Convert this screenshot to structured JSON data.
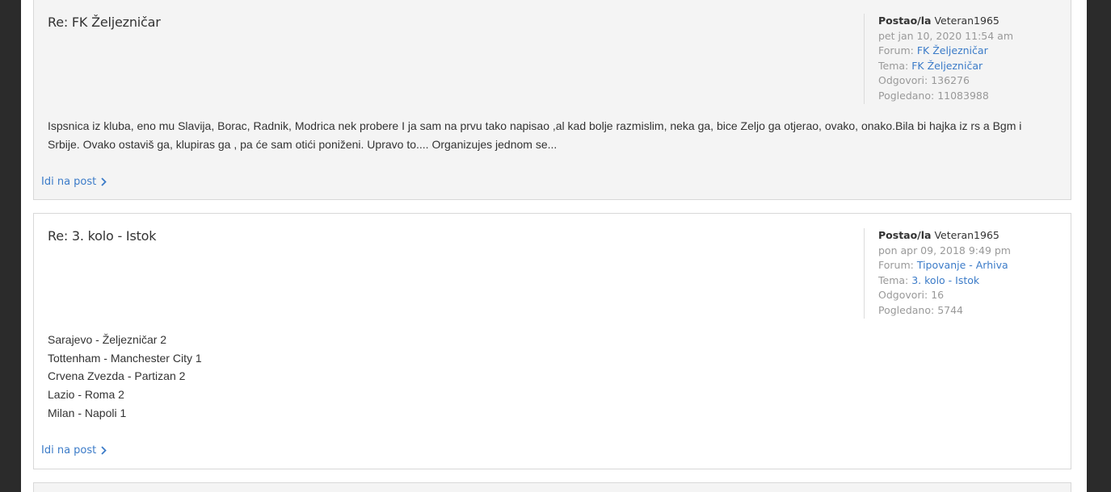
{
  "posts": [
    {
      "title": "Re: FK Željezničar",
      "meta": {
        "author_label": "Postao/la",
        "author": "Veteran1965",
        "date": "pet jan 10, 2020 11:54 am",
        "forum_label": "Forum:",
        "forum": "FK Željezničar",
        "topic_label": "Tema:",
        "topic": "FK Željezničar",
        "replies_label": "Odgovori:",
        "replies": "136276",
        "views_label": "Pogledano:",
        "views": "11083988"
      },
      "body_lines": [
        "Ispsnica iz kluba, eno mu Slavija, Borac, Radnik, Modrica nek probere I ja sam na prvu tako napisao ,al kad bolje razmislim, neka ga, bice Zeljo ga otjerao, ovako, onako.Bila bi hajka iz rs a Bgm i",
        "Srbije. Ovako ostaviš ga, klupiras ga , pa će sam otići poniženi. Upravo to.... Organizujes jednom se..."
      ],
      "goto_label": "Idi na post"
    },
    {
      "title": "Re: 3. kolo - Istok",
      "meta": {
        "author_label": "Postao/la",
        "author": "Veteran1965",
        "date": "pon apr 09, 2018 9:49 pm",
        "forum_label": "Forum:",
        "forum": "Tipovanje - Arhiva",
        "topic_label": "Tema:",
        "topic": "3. kolo - Istok",
        "replies_label": "Odgovori:",
        "replies": "16",
        "views_label": "Pogledano:",
        "views": "5744"
      },
      "body_lines": [
        "Sarajevo - Željezničar 2",
        "Tottenham - Manchester City 1",
        "Crvena Zvezda - Partizan 2",
        "Lazio - Roma 2",
        "Milan - Napoli 1"
      ],
      "goto_label": "Idi na post"
    }
  ],
  "icons": {
    "goto": "chevron-right-icon"
  },
  "colors": {
    "link": "#3b7bc8",
    "text": "#333333",
    "muted": "#999999",
    "post_bg_alt": "#f4f4f4",
    "page_frame": "#2b2b2b"
  }
}
